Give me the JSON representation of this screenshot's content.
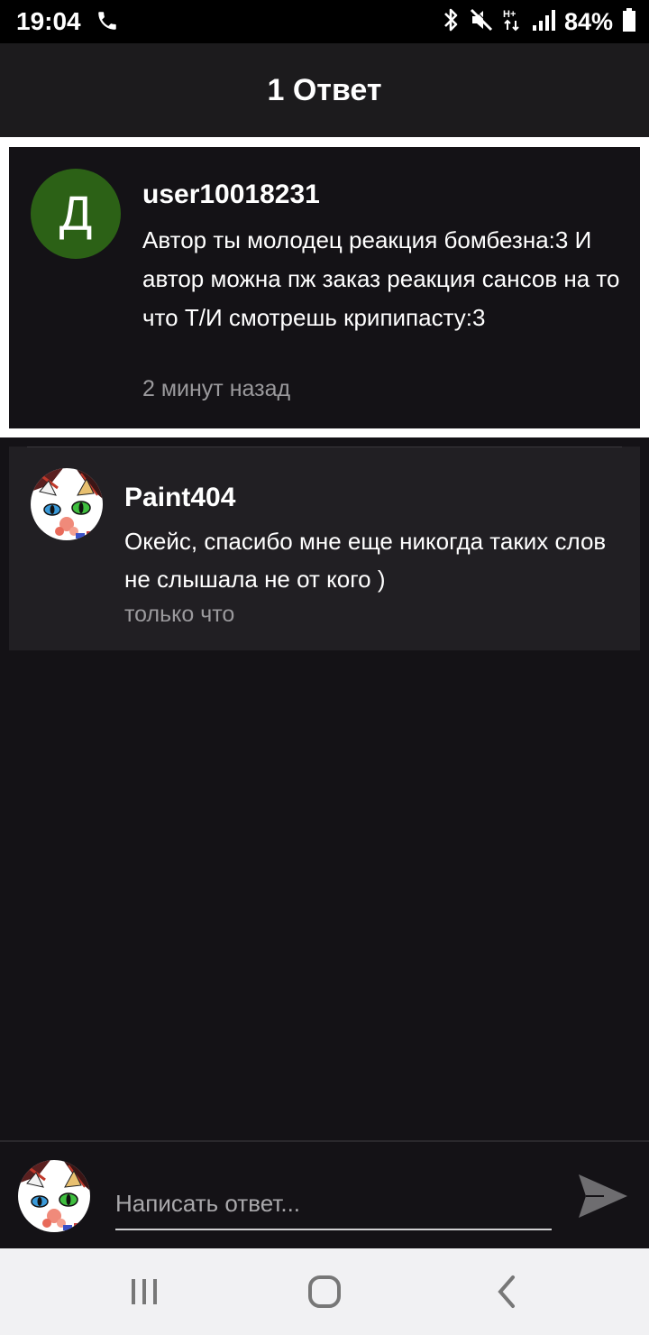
{
  "status_bar": {
    "time": "19:04",
    "battery_percent": "84%",
    "icons": [
      "phone-icon",
      "bluetooth-icon",
      "mute-icon",
      "data-icon",
      "signal-icon",
      "battery-icon"
    ]
  },
  "header": {
    "title": "1 Ответ"
  },
  "parent_comment": {
    "avatar_letter": "Д",
    "avatar_color": "#2c6116",
    "username": "user10018231",
    "text": "Автор ты молодец реакция бомбезна:3 И автор можна пж заказ реакция сансов на то что Т/И смотрешь крипипасту:3",
    "time": "2 минут назад"
  },
  "reply": {
    "username": "Paint404",
    "text": "Окейс, спасибо мне еще никогда таких слов не слышала не от кого )",
    "time": "только что"
  },
  "composer": {
    "placeholder": "Написать ответ..."
  },
  "colors": {
    "background": "#141216",
    "header": "#1c1b1d",
    "reply_card": "#211f23",
    "muted_text": "#9b9a9d"
  }
}
